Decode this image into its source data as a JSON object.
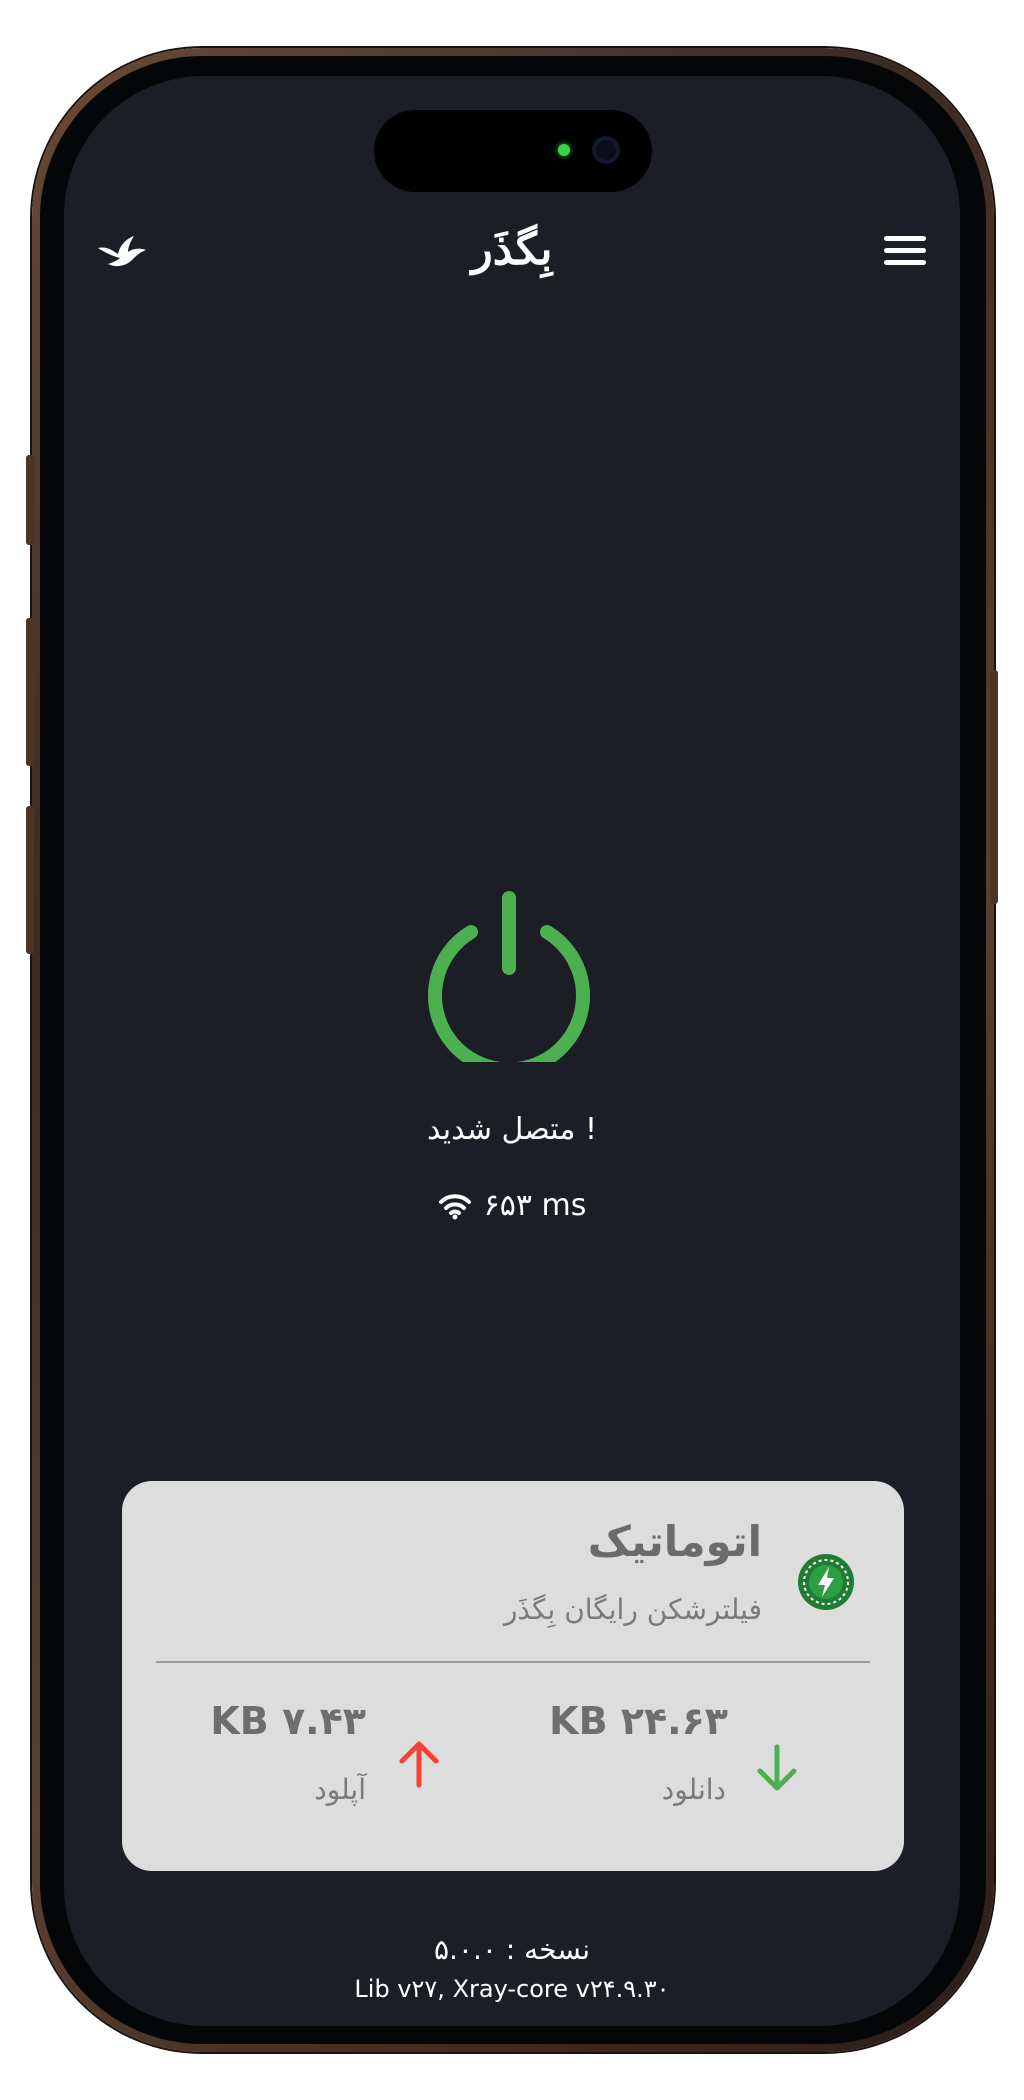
{
  "header": {
    "title": "بِگذَر"
  },
  "connection": {
    "status": "متصل شدید !",
    "ping": "۶۵۳ ms",
    "power_color": "#4caf50"
  },
  "server": {
    "name": "اتوماتیک",
    "description": "فیلترشکن رایگان بِگذَر"
  },
  "stats": {
    "download_value": "KB ۲۴.۶۳",
    "download_label": "دانلود",
    "upload_value": "KB ۷.۴۳",
    "upload_label": "آپلود",
    "download_color": "#4caf50",
    "upload_color": "#f44336"
  },
  "footer": {
    "version": "نسخه : ۵.۰.۰",
    "lib": "Lib v۲۷, Xray-core v۲۴.۹.۳۰"
  },
  "icons": {
    "logo": "bird-icon",
    "menu": "hamburger-menu-icon",
    "power": "power-icon",
    "wifi": "wifi-icon",
    "server": "lightning-badge-icon",
    "download": "arrow-down-icon",
    "upload": "arrow-up-icon"
  }
}
